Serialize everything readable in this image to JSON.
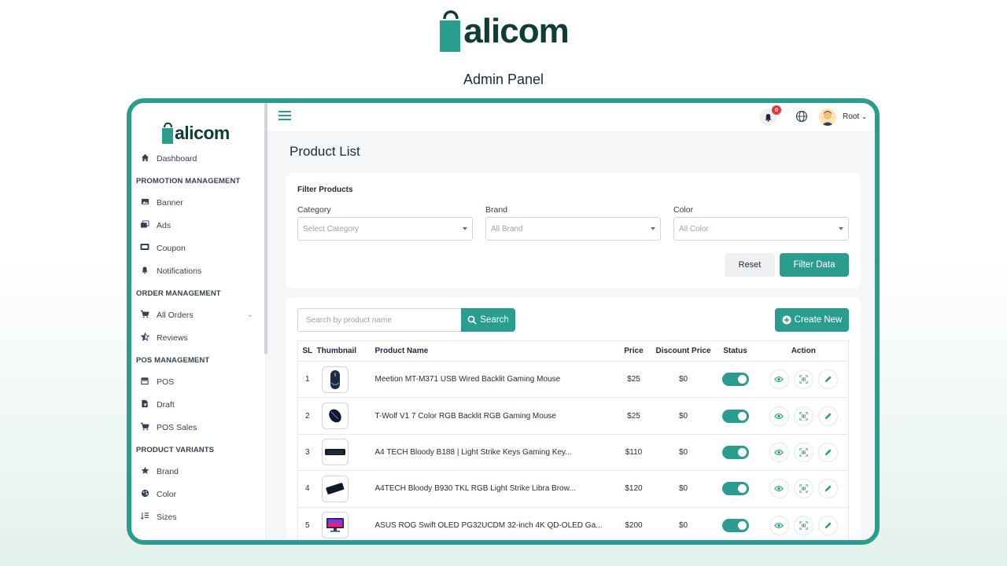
{
  "brand": {
    "name": "alicom",
    "subtitle": "Admin Panel",
    "accent": "#2a9d8f",
    "dark": "#0f3d33"
  },
  "sidebar": {
    "items": [
      {
        "type": "item",
        "label": "Dashboard",
        "icon": "home-icon"
      },
      {
        "type": "section",
        "label": "PROMOTION MANAGEMENT"
      },
      {
        "type": "item",
        "label": "Banner",
        "icon": "image-icon"
      },
      {
        "type": "item",
        "label": "Ads",
        "icon": "images-icon"
      },
      {
        "type": "item",
        "label": "Coupon",
        "icon": "ticket-icon"
      },
      {
        "type": "item",
        "label": "Notifications",
        "icon": "bell-icon"
      },
      {
        "type": "section",
        "label": "ORDER MANAGEMENT"
      },
      {
        "type": "item",
        "label": "All Orders",
        "icon": "cart-icon",
        "expandable": true
      },
      {
        "type": "item",
        "label": "Reviews",
        "icon": "star-half-icon"
      },
      {
        "type": "section",
        "label": "POS MANAGEMENT"
      },
      {
        "type": "item",
        "label": "POS",
        "icon": "store-icon"
      },
      {
        "type": "item",
        "label": "Draft",
        "icon": "draft-icon"
      },
      {
        "type": "item",
        "label": "POS Sales",
        "icon": "cart-icon"
      },
      {
        "type": "section",
        "label": "PRODUCT VARIANTS"
      },
      {
        "type": "item",
        "label": "Brand",
        "icon": "star-icon"
      },
      {
        "type": "item",
        "label": "Color",
        "icon": "palette-icon"
      },
      {
        "type": "item",
        "label": "Sizes",
        "icon": "sort-list-icon"
      }
    ]
  },
  "topbar": {
    "notification_count": "0",
    "user": "Root"
  },
  "page": {
    "title": "Product List"
  },
  "filter": {
    "title": "Filter Products",
    "category": {
      "label": "Category",
      "value": "Select Category"
    },
    "brand": {
      "label": "Brand",
      "value": "All Brand"
    },
    "color": {
      "label": "Color",
      "value": "All Color"
    },
    "reset_label": "Reset",
    "submit_label": "Filter Data"
  },
  "search": {
    "placeholder": "Search by product name",
    "button_label": "Search"
  },
  "create_label": "Create New",
  "table": {
    "headers": {
      "sl": "SL",
      "thumbnail": "Thumbnail",
      "name": "Product Name",
      "price": "Price",
      "discount": "Discount Price",
      "status": "Status",
      "action": "Action"
    },
    "rows": [
      {
        "sl": "1",
        "name": "Meetion MT-M371 USB Wired Backlit Gaming Mouse",
        "price": "$25",
        "discount": "$0",
        "active": true,
        "thumb": "mouse"
      },
      {
        "sl": "2",
        "name": "T-Wolf V1 7 Color RGB Backlit RGB Gaming Mouse",
        "price": "$25",
        "discount": "$0",
        "active": true,
        "thumb": "mouse2"
      },
      {
        "sl": "3",
        "name": "A4 TECH Bloody B188 | Light Strike Keys Gaming Key...",
        "price": "$110",
        "discount": "$0",
        "active": true,
        "thumb": "keyboard"
      },
      {
        "sl": "4",
        "name": "A4TECH Bloody B930 TKL RGB Light Strike Libra Brow...",
        "price": "$120",
        "discount": "$0",
        "active": true,
        "thumb": "keyboard2"
      },
      {
        "sl": "5",
        "name": "ASUS ROG Swift OLED PG32UCDM 32-inch 4K QD-OLED Ga...",
        "price": "$200",
        "discount": "$0",
        "active": true,
        "thumb": "monitor"
      }
    ]
  }
}
